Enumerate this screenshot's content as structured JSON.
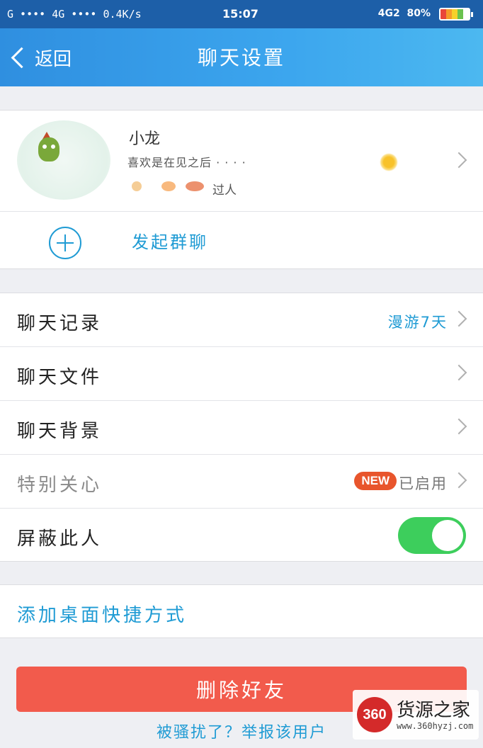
{
  "status_bar": {
    "left_text": "G •••• 4G •••• 0.4K/s",
    "time": "15:07",
    "network": "4G2",
    "battery_text": "80%",
    "battery_level": 0.8
  },
  "header": {
    "back_label": "返回",
    "title": "聊天设置"
  },
  "profile": {
    "name": "小龙",
    "status": "喜欢是在见之后 · · · ·",
    "extra": "过人"
  },
  "group_chat": {
    "label": "发起群聊"
  },
  "settings": {
    "chat_history_label": "聊天记录",
    "chat_history_value": "漫游7天",
    "chat_files_label": "聊天文件",
    "chat_background_label": "聊天背景",
    "special_care_label": "特别关心",
    "special_care_badge": "NEW",
    "special_care_value": "已启用",
    "block_label": "屏蔽此人",
    "block_enabled": true
  },
  "shortcut": {
    "label": "添加桌面快捷方式"
  },
  "actions": {
    "delete_label": "删除好友",
    "report_label": "被骚扰了？举报该用户"
  },
  "watermark": {
    "logo": "360",
    "title": "货源之家",
    "url": "www.360hyzj.com"
  },
  "colors": {
    "accent": "#1f9bd4",
    "toggle_on": "#3dce5c",
    "delete_button": "#f25b4c",
    "badge": "#e8552c"
  }
}
